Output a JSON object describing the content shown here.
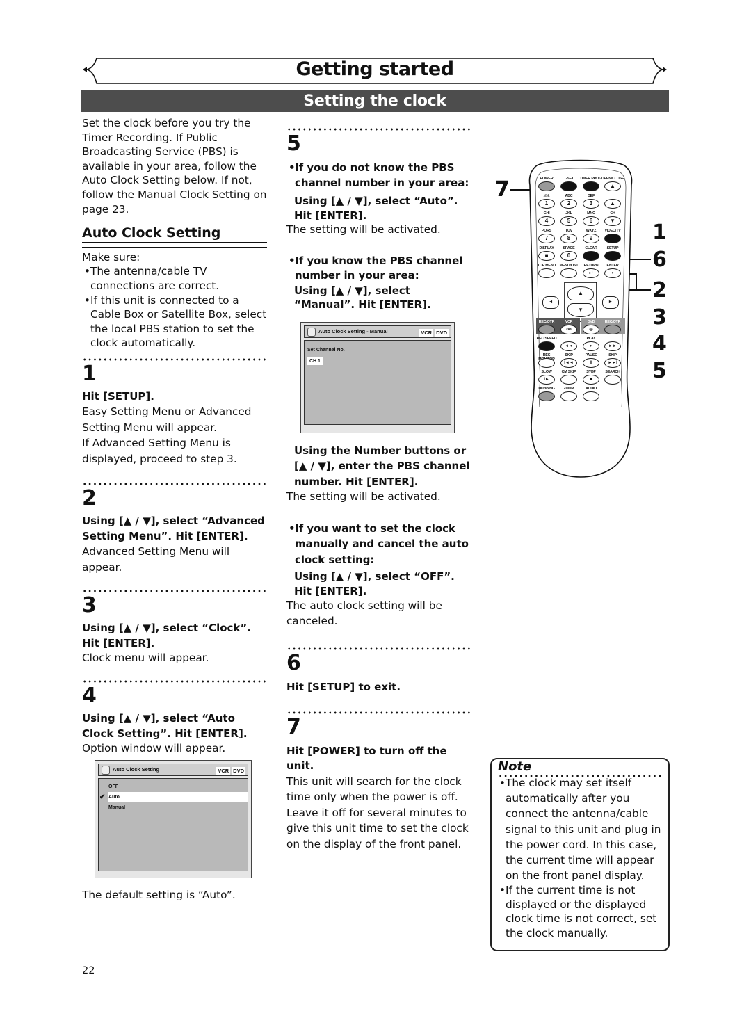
{
  "header": {
    "chapter_title": "Getting started",
    "section_title": "Setting the clock"
  },
  "colors": {
    "section_bar": "#4d4d4d",
    "osd_body": "#b9b9b9",
    "text": "#111111"
  },
  "intro": "Set the clock before you try the Timer Recording. If Public Broadcasting Service (PBS) is available in your area, follow the Auto Clock Setting below. If not, follow the Manual Clock Setting on page 23.",
  "auto_clock": {
    "heading": "Auto Clock Setting",
    "make_sure": "Make sure:",
    "bullets": [
      "The antenna/cable TV connections are correct.",
      "If this unit is connected to a Cable Box or Satellite Box, select the local PBS station to set the clock automatically."
    ]
  },
  "steps": {
    "s1": {
      "num": "1",
      "instruction": "Hit [SETUP].",
      "desc1": "Easy Setting Menu or Advanced Setting Menu will appear.",
      "desc2": "If Advanced Setting Menu is displayed, proceed to step 3."
    },
    "s2": {
      "num": "2",
      "instruction": "Using [▲ / ▼], select “Advanced Setting Menu”. Hit [ENTER].",
      "desc": "Advanced Setting Menu will appear."
    },
    "s3": {
      "num": "3",
      "instruction": "Using [▲ / ▼], select “Clock”. Hit [ENTER].",
      "desc": "Clock menu will appear."
    },
    "s4": {
      "num": "4",
      "instruction": "Using [▲ / ▼], select “Auto Clock Setting”. Hit [ENTER].",
      "desc": "Option window will appear.",
      "screen": {
        "title": "Auto Clock Setting",
        "tags": [
          "VCR",
          "DVD"
        ],
        "options": [
          "OFF",
          "Auto",
          "Manual"
        ],
        "selected": "Auto"
      },
      "footer": "The default setting is “Auto”."
    },
    "s5": {
      "num": "5",
      "case_a": {
        "condition": "If you do not know the PBS channel number in your area:",
        "instruction": "Using [▲ / ▼], select “Auto”. Hit [ENTER].",
        "result": "The setting will be activated."
      },
      "case_b": {
        "condition": "If you know the PBS channel number in your area:",
        "instruction": "Using [▲ / ▼], select “Manual”. Hit [ENTER].",
        "screen": {
          "title": "Auto Clock Setting - Manual",
          "tags": [
            "VCR",
            "DVD"
          ],
          "label": "Set Channel No.",
          "value": "CH 1"
        },
        "instruction2": "Using the Number buttons or [▲ / ▼], enter the PBS channel number. Hit [ENTER].",
        "result": "The setting will be activated."
      },
      "case_c": {
        "condition": "If you want to set the clock manually and cancel the auto clock setting:",
        "instruction": "Using [▲ / ▼], select “OFF”. Hit [ENTER].",
        "result": "The auto clock setting will be canceled."
      }
    },
    "s6": {
      "num": "6",
      "instruction": "Hit [SETUP] to exit."
    },
    "s7": {
      "num": "7",
      "instruction": "Hit [POWER] to turn off the unit.",
      "desc": "This unit will search for the clock time only when the power is off. Leave it off for several minutes to give this unit time to set the clock on the display of the front panel."
    }
  },
  "remote": {
    "callouts_left": [
      "7"
    ],
    "callouts_right": [
      "1",
      "6",
      "2",
      "3",
      "4",
      "5"
    ],
    "rows": [
      {
        "labels": [
          "POWER",
          "T-SET",
          "TIMER PROG.",
          "OPEN/CLOSE"
        ],
        "keys": [
          "",
          "",
          "",
          "▲"
        ]
      },
      {
        "labels": [
          ".@/:",
          "ABC",
          "DEF",
          ""
        ],
        "keys": [
          "1",
          "2",
          "3",
          "▲"
        ]
      },
      {
        "labels": [
          "GHI",
          "JKL",
          "MNO",
          "CH"
        ],
        "keys": [
          "4",
          "5",
          "6",
          "▼"
        ]
      },
      {
        "labels": [
          "PQRS",
          "TUV",
          "WXYZ",
          "VIDEO/TV"
        ],
        "keys": [
          "7",
          "8",
          "9",
          ""
        ]
      },
      {
        "labels": [
          "DISPLAY",
          "SPACE",
          "CLEAR",
          "SETUP"
        ],
        "keys": [
          "■",
          "0",
          "",
          ""
        ]
      },
      {
        "labels": [
          "TOP MENU",
          "MENU/LIST",
          "RETURN",
          "ENTER"
        ],
        "keys": [
          "",
          "",
          "↵",
          "•"
        ]
      }
    ],
    "nav": {
      "up": "▲",
      "down": "▼",
      "left": "◄",
      "right": "►"
    },
    "rows2": [
      {
        "labels": [
          "REC/OTR",
          "VCR",
          "DVD",
          "REC/OTR"
        ],
        "keys": [
          "",
          "oo",
          "◎",
          ""
        ]
      },
      {
        "labels": [
          "REC SPEED",
          "",
          "PLAY",
          ""
        ],
        "keys": [
          "",
          "◄◄",
          "►",
          "►►"
        ]
      },
      {
        "labels": [
          "REC MONITOR",
          "SKIP",
          "PAUSE",
          "SKIP"
        ],
        "keys": [
          "",
          "I◄◄",
          "II",
          "►►I"
        ]
      },
      {
        "labels": [
          "SLOW",
          "CM SKIP",
          "STOP",
          "SEARCH"
        ],
        "keys": [
          "I►",
          "",
          "■",
          ""
        ]
      },
      {
        "labels": [
          "DUBBING",
          "ZOOM",
          "AUDIO",
          ""
        ],
        "keys": [
          "",
          "",
          "",
          ""
        ]
      }
    ]
  },
  "note": {
    "title": "Note",
    "items": [
      "The clock may set itself automatically after you connect the antenna/cable signal to this unit and plug in the power cord. In this case, the current time will appear on the front panel display.",
      "If the current time is not displayed or the displayed clock time is not correct, set the clock manually."
    ]
  },
  "page_number": "22"
}
